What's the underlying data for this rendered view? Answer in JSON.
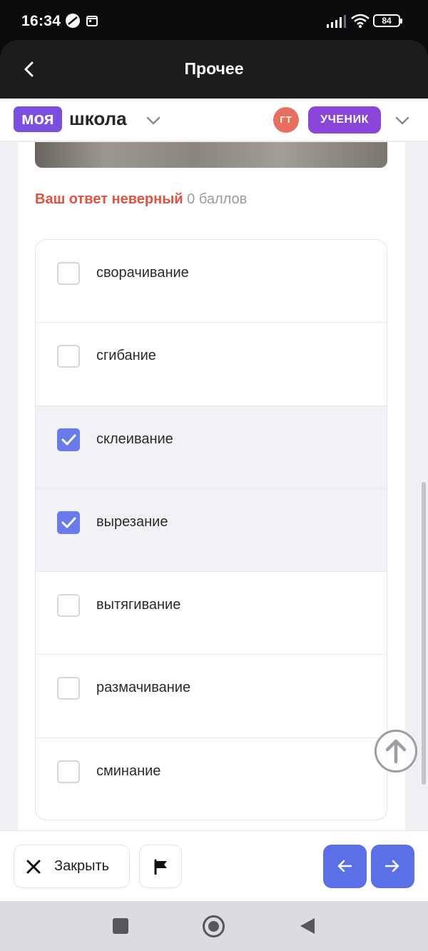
{
  "status_bar": {
    "time": "16:34",
    "battery": "84",
    "icons": [
      "no-disturb-icon",
      "calendar-icon",
      "signal-icon",
      "wifi-icon",
      "battery-icon"
    ]
  },
  "header": {
    "title": "Прочее",
    "back_icon": "chevron-left-icon"
  },
  "brand": {
    "logo_part1": "моя",
    "logo_part2": "школа",
    "logo_color": "#7a4fe0",
    "user_initials": "ГТ",
    "avatar_color": "#ea6e5e",
    "role": "УЧЕНИК",
    "role_color": "#8a46d9"
  },
  "result": {
    "verdict": "Ваш ответ неверный",
    "score": "0 баллов",
    "verdict_color": "#e0533f"
  },
  "options": [
    {
      "label": "сворачивание",
      "checked": false
    },
    {
      "label": "сгибание",
      "checked": false
    },
    {
      "label": "склеивание",
      "checked": true
    },
    {
      "label": "вырезание",
      "checked": true
    },
    {
      "label": "вытягивание",
      "checked": false
    },
    {
      "label": "размачивание",
      "checked": false
    },
    {
      "label": "сминание",
      "checked": false
    }
  ],
  "footer": {
    "close_label": "Закрыть",
    "close_icon": "close-icon",
    "flag_icon": "flag-icon",
    "prev_icon": "arrow-left-icon",
    "next_icon": "arrow-right-icon",
    "accent": "#5b6fe6"
  },
  "android_nav": [
    "recents-icon",
    "home-icon",
    "back-icon"
  ]
}
